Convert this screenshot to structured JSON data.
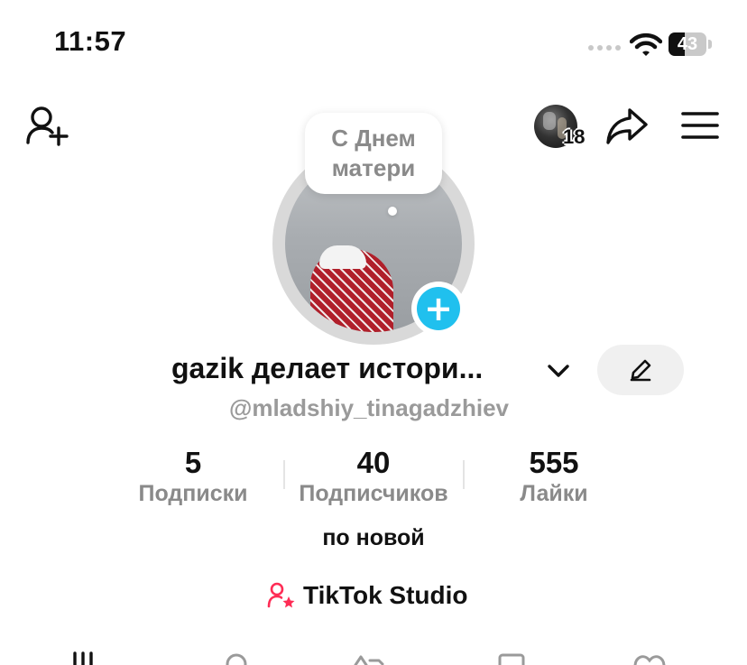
{
  "status_bar": {
    "time": "11:57",
    "battery": "43",
    "battery_level": 0.43
  },
  "toolbar": {
    "story_count": "18",
    "icons": [
      "add-friend-icon",
      "story-avatar",
      "share-icon",
      "menu-icon"
    ]
  },
  "profile": {
    "note": "С Днем\nматери",
    "display_name": "gazik делает истори...",
    "username": "@mladshiy_tinagadzhiev",
    "bio": "по новой"
  },
  "stats": [
    {
      "value": "5",
      "label": "Подписки"
    },
    {
      "value": "40",
      "label": "Подписчиков"
    },
    {
      "value": "555",
      "label": "Лайки"
    }
  ],
  "studio": {
    "label": "TikTok Studio"
  },
  "tabs": [
    "videos-grid-tab",
    "private-tab",
    "reposts-tab",
    "favorites-tab",
    "liked-tab"
  ],
  "colors": {
    "accent_blue": "#20c0ee",
    "studio_pink": "#fe2c55",
    "muted_text": "#8a8a8a"
  }
}
